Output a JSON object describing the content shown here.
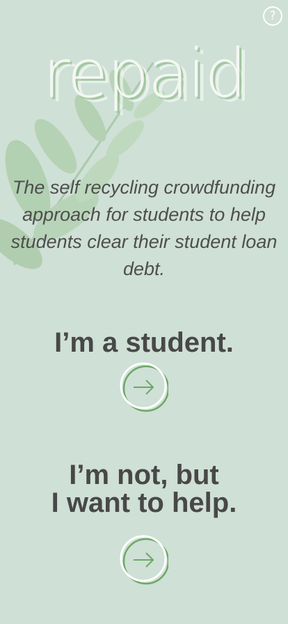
{
  "app": {
    "logo_text": "repaid"
  },
  "tagline": "The self recycling crowdfunding approach for students to help students clear their student loan debt.",
  "options": {
    "student": {
      "label": "I’m a student."
    },
    "helper": {
      "label_line1": "I’m not, but",
      "label_line2": "I want to help."
    }
  },
  "icons": {
    "help": "question-mark-icon",
    "next": "arrow-right-circle-icon"
  },
  "colors": {
    "background": "#cfe0d6",
    "accent": "#6da864",
    "text": "#4a4a4a"
  }
}
